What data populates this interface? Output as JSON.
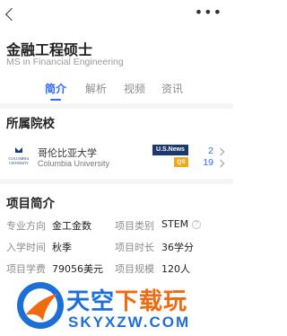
{
  "program": {
    "name_cn": "金融工程硕士",
    "name_en": "MS in Financial Engineering"
  },
  "tabs": [
    {
      "label": "简介",
      "active": true
    },
    {
      "label": "解析",
      "active": false
    },
    {
      "label": "视频",
      "active": false
    },
    {
      "label": "资讯",
      "active": false
    }
  ],
  "school_section": {
    "title": "所属院校",
    "university": {
      "logo_text": "COLUMBIA\nUNIVERSITY",
      "name_cn": "哥伦比亚大学",
      "name_en": "Columbia University",
      "rankings": [
        {
          "source": "U.S.News",
          "rank": "2"
        },
        {
          "source": "QS",
          "rank": "19"
        }
      ]
    }
  },
  "intro_section": {
    "title": "项目简介",
    "rows": [
      {
        "l1": "专业方向",
        "v1": "金工金数",
        "l2": "项目类别",
        "v2": "STEM"
      },
      {
        "l1": "入学时间",
        "v1": "秋季",
        "l2": "项目时长",
        "v2": "36学分"
      },
      {
        "l1": "项目学费",
        "v1": "79056美元",
        "l2": "项目规模",
        "v2": "120人"
      }
    ]
  },
  "watermark": {
    "text_cn_main": "天空",
    "text_cn_accent": "下载玩",
    "text_en": "SKYXZW.COM"
  },
  "colors": {
    "accent": "#2f6bff",
    "watermark_blue": "#1d6fd8",
    "watermark_orange": "#f26a0f"
  }
}
